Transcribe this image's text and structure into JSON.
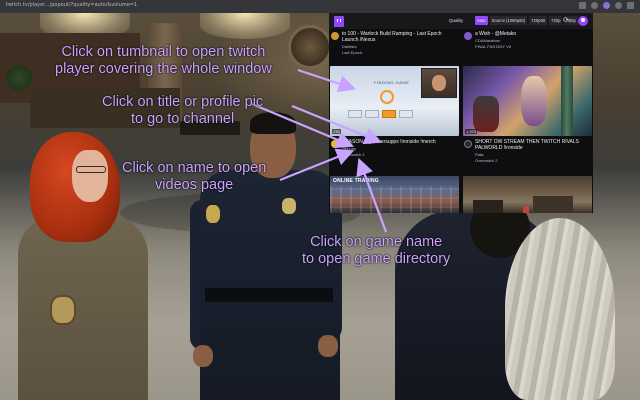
{
  "browser": {
    "url": "twitch.tv/player.../popout/?quality=auto/&volume=1",
    "icons": [
      "puzzle-icon",
      "star-icon",
      "extension-icon",
      "profile-icon",
      "menu-icon"
    ]
  },
  "overlay": {
    "quality_label": "Quality",
    "quality_options": [
      {
        "label": "Auto",
        "active": true
      },
      {
        "label": "Source (1080p60)",
        "active": false
      },
      {
        "label": "720p60",
        "active": false
      },
      {
        "label": "720p",
        "active": false
      },
      {
        "label": "480p",
        "active": false
      }
    ],
    "refresh_symbol": "⟳",
    "accent_color": "#9147ff",
    "streams": [
      {
        "title_line1": "to 100 - Warlock Build Ramping - Last Epoch",
        "title_line2": "Launch /Nexus",
        "channel": "DaMisto",
        "game": "Last Epoch",
        "viewers": ""
      },
      {
        "title_line1": "a Wish - @Metako",
        "title_line2": "",
        "channel": "CDAMarathon",
        "game": "FINAL FANTASY VII",
        "viewers": ""
      },
      {
        "title_line1": "SEASON 9 grinmersupps !ironside !merch",
        "title_line2": "",
        "channel": "Grinupp",
        "game": "Overwatch 2",
        "viewers": "235",
        "thumb_title": "FINDING GAME"
      },
      {
        "title_line1": "SHORT OW STREAM THEN TWITCH RIVALS",
        "title_line2": "PALWORLD !ironside",
        "channel": "Flats",
        "game": "Overwatch 2",
        "viewers": "1,373"
      },
      {
        "title_line1": "",
        "title_line2": "",
        "channel": "",
        "game": "",
        "viewers": "",
        "thumb_label": "ONLINE TRADING"
      },
      {
        "title_line1": "",
        "title_line2": "",
        "channel": "",
        "game": "",
        "viewers": ""
      }
    ]
  },
  "annotations": {
    "thumbnail": [
      "Click on tumbnail to open twitch",
      "player covering the whole window"
    ],
    "title": [
      "Click on title or profile pic",
      "to go to channel"
    ],
    "name": [
      "Click on name to open",
      "videos page"
    ],
    "game": [
      "Click on game name",
      "to open game directory"
    ],
    "color": "#c9a3ff"
  }
}
